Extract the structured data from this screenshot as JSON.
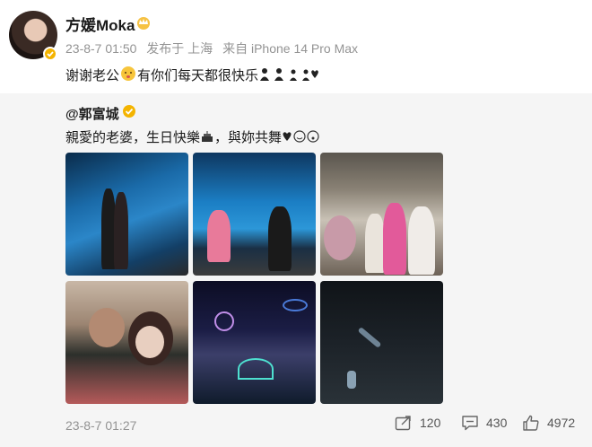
{
  "header": {
    "username": "方媛Moka",
    "date": "23-8-7 01:50",
    "published_from": "发布于 上海",
    "device": "来自 iPhone 14 Pro Max"
  },
  "post": {
    "text_part1": "谢谢老公",
    "text_part2": "有你们每天都很快乐"
  },
  "repost": {
    "mention": "@郭富城",
    "text_part1": "親愛的老婆，生日快樂",
    "text_part2": "，與妳共舞",
    "date": "23-8-7 01:27",
    "shares": "120",
    "comments": "430",
    "likes": "4972"
  },
  "colors": {
    "meta_gray": "#939393",
    "badge_gold": "#f4b400",
    "repost_bg": "#f5f5f5"
  },
  "icons": [
    "crown-icon",
    "verified-icon",
    "share-icon",
    "comment-icon",
    "like-icon"
  ]
}
